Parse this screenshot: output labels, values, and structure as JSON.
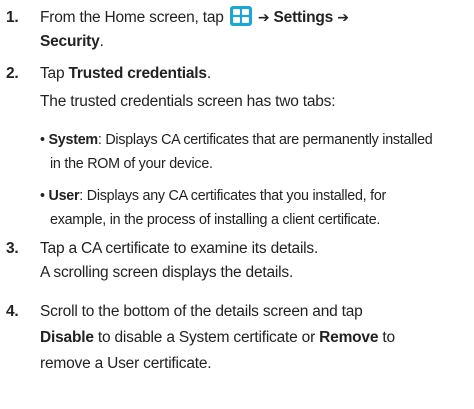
{
  "steps": [
    {
      "number": "1.",
      "line1_pre": "From the Home screen, tap",
      "icon": "apps-grid-icon",
      "arrow1": "➔",
      "settings": "Settings",
      "arrow2": "➔",
      "security": "Security",
      "security_period": "."
    },
    {
      "number": "2.",
      "pre": "Tap ",
      "bold": "Trusted credentials",
      "post": ".",
      "detail": "The trusted credentials screen has two tabs:",
      "bullets": [
        {
          "marker": "•",
          "term": "System",
          "line1": ": Displays CA certificates that are permanently installed",
          "line2": "in the ROM of your device."
        },
        {
          "marker": "•",
          "term": "User",
          "line1": ": Displays any CA certificates that you installed, for",
          "line2": "example, in the process of installing a client certificate."
        }
      ]
    },
    {
      "number": "3.",
      "text": "Tap a CA certificate to examine its details.",
      "detail": "A scrolling screen displays the details."
    },
    {
      "number": "4.",
      "line1": "Scroll to the bottom of the details screen and tap",
      "disable": "Disable",
      "mid": " to disable a System certificate or ",
      "remove": "Remove",
      "post": " to",
      "line3": "remove a User certificate."
    }
  ],
  "colors": {
    "icon": "#1aa6d8",
    "text": "#222222"
  }
}
